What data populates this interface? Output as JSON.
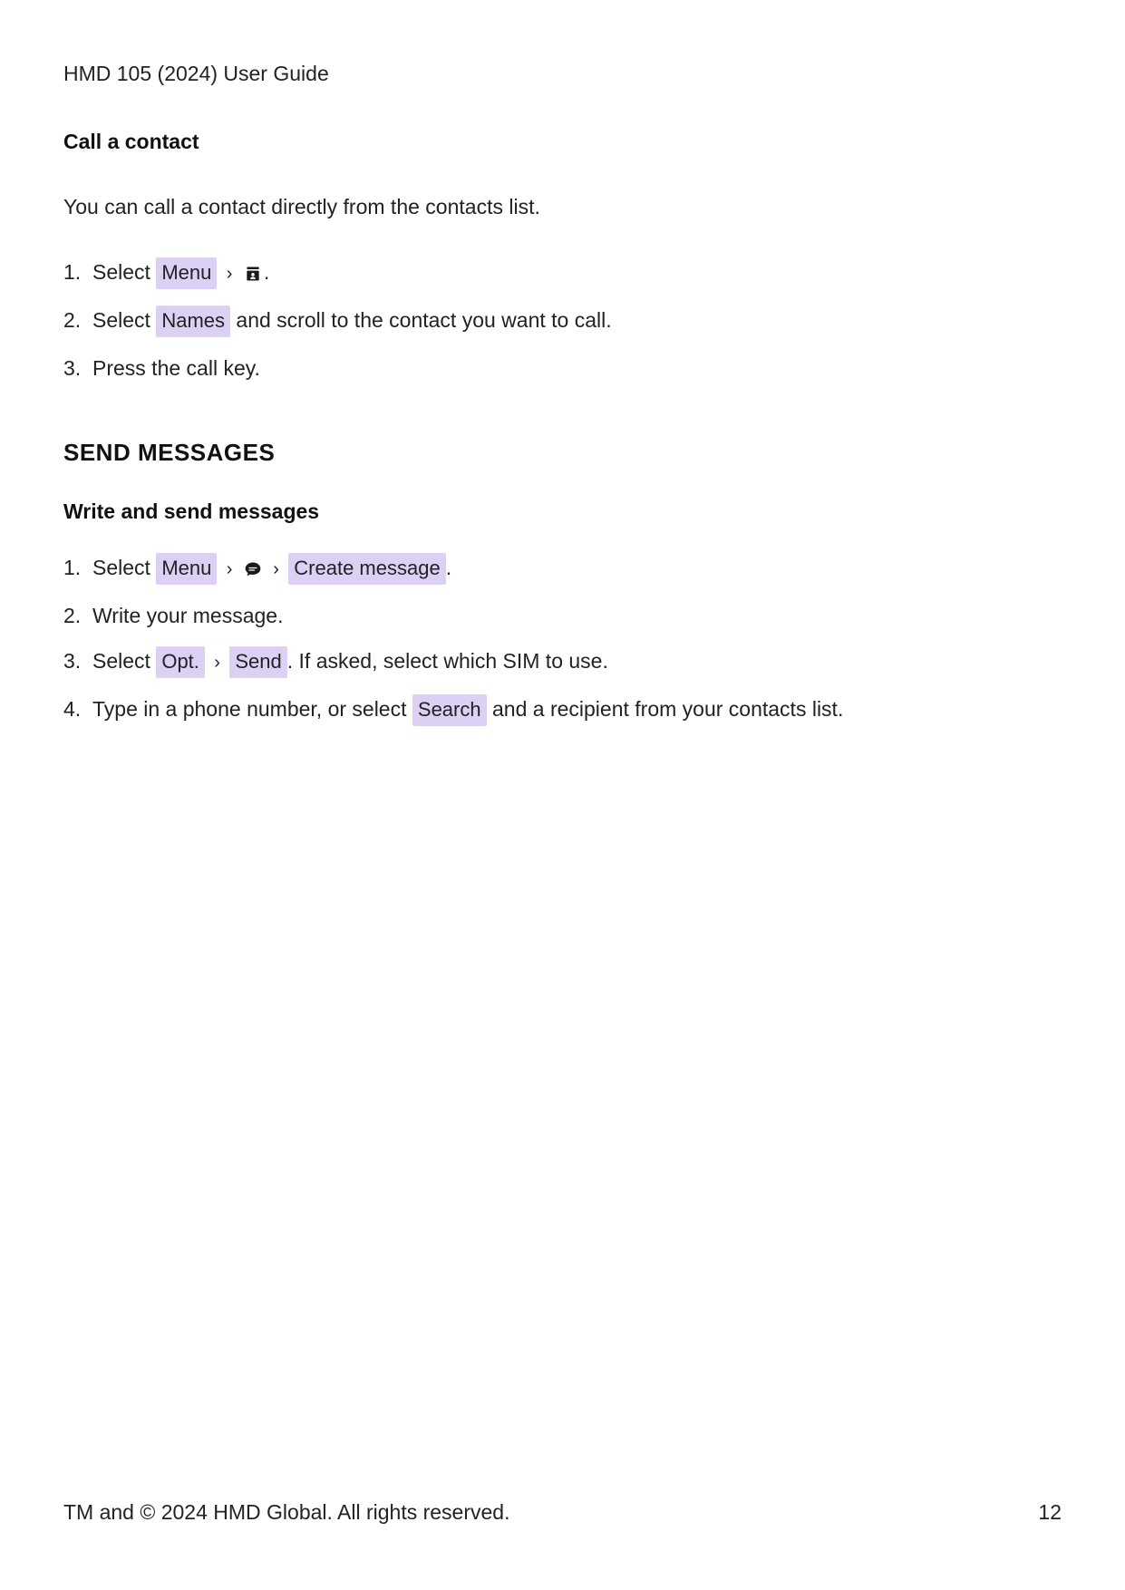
{
  "header": {
    "title": "HMD 105 (2024) User Guide"
  },
  "callContact": {
    "heading": "Call a contact",
    "intro": "You can call a contact directly from the contacts list.",
    "steps": {
      "step1_prefix": "Select ",
      "step1_menu": "Menu",
      "step1_suffix": ".",
      "step2_prefix": "Select ",
      "step2_names": "Names",
      "step2_suffix": " and scroll to the contact you want to call.",
      "step3": "Press the call key."
    }
  },
  "sendMessages": {
    "heading": "SEND MESSAGES",
    "subheading": "Write and send messages",
    "steps": {
      "step1_prefix": "Select ",
      "step1_menu": "Menu",
      "step1_create": "Create message",
      "step1_suffix": ".",
      "step2": "Write your message.",
      "step3_prefix": "Select ",
      "step3_opt": "Opt.",
      "step3_send": "Send",
      "step3_suffix": ". If asked, select which SIM to use.",
      "step4_prefix": "Type in a phone number, or select ",
      "step4_search": "Search",
      "step4_suffix": " and a recipient from your contacts list."
    }
  },
  "footer": {
    "copyright": "TM and © 2024 HMD Global. All rights reserved.",
    "page": "12"
  },
  "symbols": {
    "chevron": "›"
  }
}
